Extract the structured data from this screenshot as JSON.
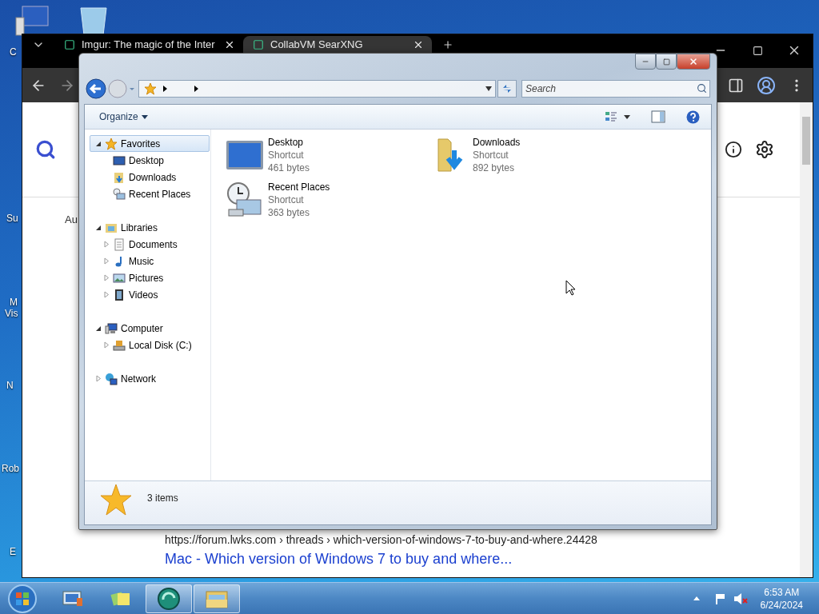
{
  "desktop": {
    "icon_labels": [
      {
        "text": "C"
      },
      {
        "text": "Su"
      },
      {
        "text": "M"
      },
      {
        "text": "Vis"
      },
      {
        "text": "N"
      },
      {
        "text": "Rob"
      },
      {
        "text": "E"
      }
    ]
  },
  "browser": {
    "tabs": [
      {
        "title": "Imgur: The magic of the Inter",
        "selected": false
      },
      {
        "title": "CollabVM SearXNG",
        "selected": true
      }
    ],
    "page": {
      "partial_text": "Au",
      "result": {
        "url": "https://forum.lwks.com",
        "breadcrumb": "› threads › which-version-of-windows-7-to-buy-and-where.24428",
        "title": "Mac - Which version of Windows 7 to buy and where..."
      }
    }
  },
  "explorer": {
    "search": {
      "placeholder": "Search"
    },
    "organize": "Organize",
    "nav": [
      {
        "label": "Favorites",
        "expanded": true,
        "selected": true,
        "children": [
          {
            "label": "Desktop",
            "selected": false
          },
          {
            "label": "Downloads",
            "selected": false
          },
          {
            "label": "Recent Places",
            "selected": false
          }
        ]
      },
      {
        "label": "Libraries",
        "expanded": true,
        "selected": false,
        "children": [
          {
            "label": "Documents",
            "expanded": false,
            "selected": false
          },
          {
            "label": "Music",
            "expanded": false,
            "selected": false
          },
          {
            "label": "Pictures",
            "expanded": false,
            "selected": false
          },
          {
            "label": "Videos",
            "expanded": false,
            "selected": false
          }
        ]
      },
      {
        "label": "Computer",
        "expanded": true,
        "selected": false,
        "children": [
          {
            "label": "Local Disk (C:)",
            "expanded": false,
            "selected": false
          }
        ]
      },
      {
        "label": "Network",
        "expanded": false,
        "selected": false
      }
    ],
    "files": [
      {
        "name": "Desktop",
        "type": "Shortcut",
        "size": "461 bytes"
      },
      {
        "name": "Downloads",
        "type": "Shortcut",
        "size": "892 bytes"
      },
      {
        "name": "Recent Places",
        "type": "Shortcut",
        "size": "363 bytes"
      }
    ],
    "status": "3 items"
  },
  "taskbar": {
    "items": [
      {
        "open": false
      },
      {
        "open": false
      },
      {
        "open": true
      },
      {
        "open": true
      }
    ],
    "clock": {
      "time": "6:53 AM",
      "date": "6/24/2024"
    }
  }
}
